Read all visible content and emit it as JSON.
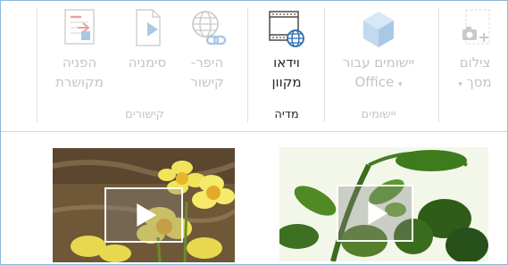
{
  "ribbon": {
    "buttons": [
      {
        "id": "screenshot",
        "label_line1": "צילום",
        "label_line2": "מסך",
        "dropdown": true
      },
      {
        "id": "office_apps",
        "label_line1": "יישומים עבור",
        "label_line2": "Office",
        "dropdown": true
      },
      {
        "id": "online_video",
        "label_line1": "וידאו",
        "label_line2": "מקוון"
      },
      {
        "id": "hyperlink",
        "label_line1": "היפר-",
        "label_line2": "קישור"
      },
      {
        "id": "bookmark",
        "label_line1": "סימניה",
        "label_line2": ""
      },
      {
        "id": "cross_reference",
        "label_line1": "הפניה",
        "label_line2": "מקושרת"
      }
    ],
    "groups": {
      "apps": "יישומים",
      "media": "מדיה",
      "links": "קישורים"
    },
    "dropdown_glyph": "▾"
  },
  "colors": {
    "accent": "#2b579a",
    "border": "#8fb6d8",
    "disabled": "#c4c4c4",
    "text": "#262626"
  }
}
